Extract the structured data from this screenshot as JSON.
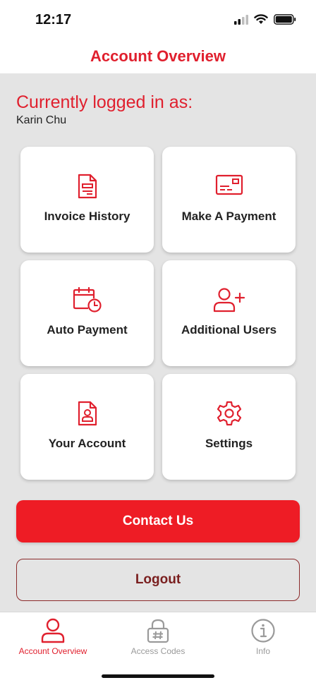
{
  "status": {
    "time": "12:17"
  },
  "header": {
    "title": "Account Overview"
  },
  "login": {
    "label": "Currently logged in as:",
    "user": "Karin Chu"
  },
  "tiles": [
    {
      "label": "Invoice History",
      "icon": "invoice-icon"
    },
    {
      "label": "Make A Payment",
      "icon": "credit-card-icon"
    },
    {
      "label": "Auto Payment",
      "icon": "calendar-clock-icon"
    },
    {
      "label": "Additional Users",
      "icon": "add-user-icon"
    },
    {
      "label": "Your Account",
      "icon": "account-badge-icon"
    },
    {
      "label": "Settings",
      "icon": "gear-icon"
    }
  ],
  "buttons": {
    "contact": "Contact Us",
    "logout": "Logout"
  },
  "tabs": [
    {
      "label": "Account Overview",
      "icon": "user-icon",
      "active": true
    },
    {
      "label": "Access Codes",
      "icon": "lock-hash-icon",
      "active": false
    },
    {
      "label": "Info",
      "icon": "info-icon",
      "active": false
    }
  ],
  "colors": {
    "accent": "#e0202e",
    "button": "#ee1c25",
    "logout_border": "#8b2a2a",
    "background": "#e4e4e4"
  }
}
